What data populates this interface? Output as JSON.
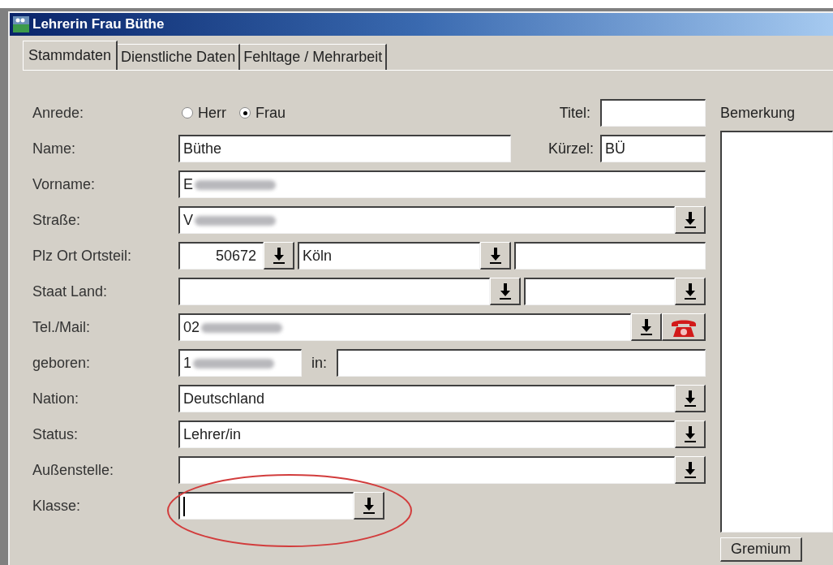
{
  "window": {
    "title": "Lehrerin Frau Büthe"
  },
  "tabs": [
    {
      "label": "Stammdaten",
      "selected": true
    },
    {
      "label": "Dienstliche Daten",
      "selected": false
    },
    {
      "label": "Fehltage / Mehrarbeit",
      "selected": false
    }
  ],
  "rows": [
    {
      "label": "Anrede:",
      "kind": "radio",
      "options": [
        {
          "label": "Herr",
          "selected": false
        },
        {
          "label": "Frau",
          "selected": true
        }
      ],
      "side_field": {
        "label": "Titel:"
      }
    },
    {
      "label": "Name:",
      "kind": "text_side",
      "fields": [
        {
          "value": "Büthe",
          "dropdown": false
        }
      ],
      "side_field": {
        "label": "Kürzel:",
        "value": "BÜ"
      }
    },
    {
      "label": "Vorname:",
      "kind": "text",
      "fields": [
        {
          "value": "E",
          "redacted": true,
          "dropdown": false
        }
      ]
    },
    {
      "label": "Straße:",
      "kind": "combo",
      "fields": [
        {
          "value": "V",
          "redacted": true,
          "dropdown": true
        }
      ]
    },
    {
      "label": "Plz Ort Ortsteil:",
      "kind": "plz",
      "fields": [
        {
          "value": "50672",
          "dropdown": true
        },
        {
          "value": "Köln",
          "dropdown": true
        },
        {
          "dropdown": false
        }
      ]
    },
    {
      "label": "Staat Land:",
      "kind": "staat",
      "fields": [
        {
          "dropdown": true
        },
        {
          "dropdown": true
        }
      ]
    },
    {
      "label": "Tel./Mail:",
      "kind": "phone",
      "fields": [
        {
          "value": "02",
          "redacted": true,
          "dropdown": true
        }
      ]
    },
    {
      "label": "geboren:",
      "kind": "born",
      "fields": [
        {
          "value": "1",
          "redacted": true,
          "dropdown": false
        },
        {
          "dropdown": false
        }
      ],
      "in_label": "in:"
    },
    {
      "label": "Nation:",
      "kind": "combo",
      "fields": [
        {
          "value": "Deutschland",
          "dropdown": true
        }
      ]
    },
    {
      "label": "Status:",
      "kind": "combo",
      "fields": [
        {
          "value": "Lehrer/in",
          "dropdown": true
        }
      ]
    },
    {
      "label": "Außenstelle:",
      "kind": "combo",
      "fields": [
        {
          "dropdown": true
        }
      ]
    },
    {
      "label": "Klasse:",
      "kind": "klasse",
      "fields": [
        {
          "dropdown": true,
          "focused": true
        }
      ],
      "highlighted": true
    }
  ],
  "remarks": {
    "label": "Bemerkung",
    "tab": "Gremium"
  }
}
